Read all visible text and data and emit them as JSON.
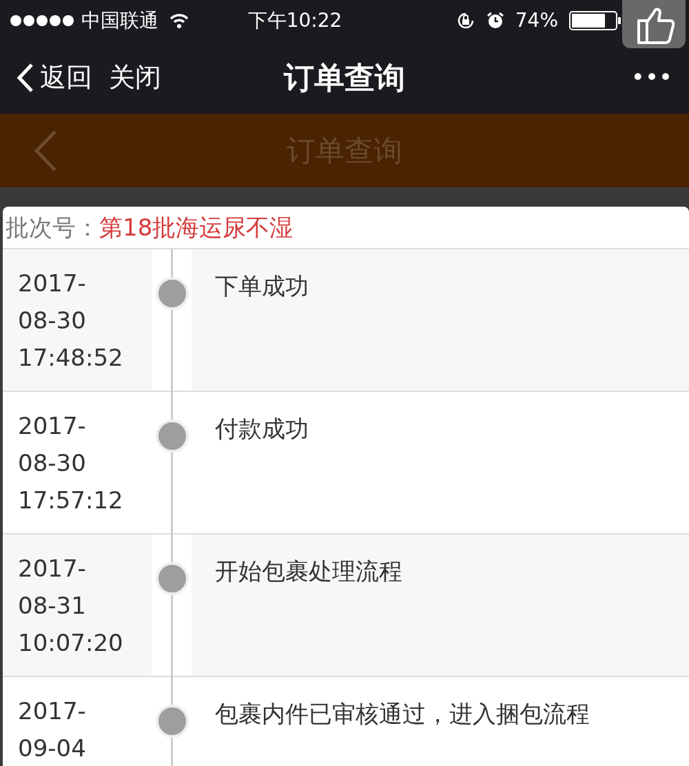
{
  "status_bar": {
    "carrier": "中国联通",
    "time": "下午10:22",
    "battery": "74%"
  },
  "nav_bar": {
    "back": "返回",
    "close": "关闭",
    "title": "订单查询",
    "more": "•••"
  },
  "page_header": {
    "title": "订单查询"
  },
  "batch": {
    "label": "批次号：",
    "value": "第18批海运尿不湿"
  },
  "timeline": [
    {
      "time": "2017-08-30 17:48:52",
      "event": "下单成功"
    },
    {
      "time": "2017-08-30 17:57:12",
      "event": "付款成功"
    },
    {
      "time": "2017-08-31 10:07:20",
      "event": "开始包裹处理流程"
    },
    {
      "time": "2017-09-04",
      "event": "包裹内件已审核通过，进入捆包流程"
    }
  ]
}
